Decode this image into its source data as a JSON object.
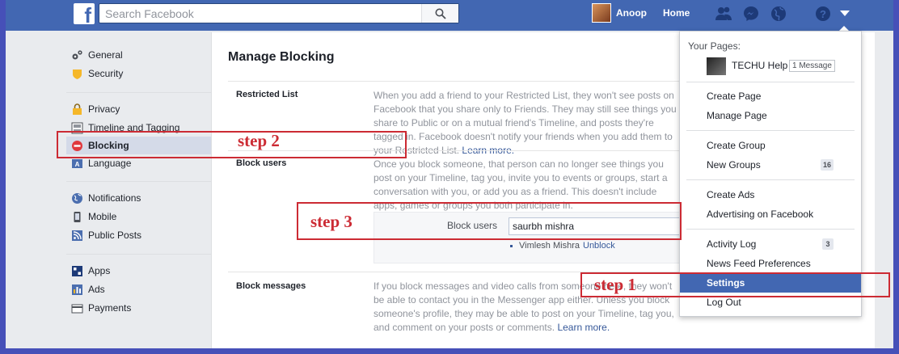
{
  "topbar": {
    "search_placeholder": "Search Facebook",
    "user_name": "Anoop",
    "home_label": "Home",
    "logo": "f"
  },
  "leftnav": {
    "groups": [
      [
        {
          "label": "General",
          "icon": "gear-icon"
        },
        {
          "label": "Security",
          "icon": "shield-icon"
        }
      ],
      [
        {
          "label": "Privacy",
          "icon": "lock-icon"
        },
        {
          "label": "Timeline and Tagging",
          "icon": "timeline-icon"
        },
        {
          "label": "Blocking",
          "icon": "block-icon",
          "active": true
        },
        {
          "label": "Language",
          "icon": "language-icon"
        }
      ],
      [
        {
          "label": "Notifications",
          "icon": "globe-icon"
        },
        {
          "label": "Mobile",
          "icon": "mobile-icon"
        },
        {
          "label": "Public Posts",
          "icon": "rss-icon"
        }
      ],
      [
        {
          "label": "Apps",
          "icon": "apps-icon"
        },
        {
          "label": "Ads",
          "icon": "ads-icon"
        },
        {
          "label": "Payments",
          "icon": "card-icon"
        }
      ]
    ]
  },
  "main": {
    "title": "Manage Blocking",
    "restricted": {
      "label": "Restricted List",
      "text": "When you add a friend to your Restricted List, they won't see posts on Facebook that you share only to Friends. They may still see things you share to Public or on a mutual friend's Timeline, and posts they're tagged in. Facebook doesn't notify your friends when you add them to your Restricted List.",
      "link": "Learn more."
    },
    "block_users": {
      "label": "Block users",
      "text": "Once you block someone, that person can no longer see things you post on your Timeline, tag you, invite you to events or groups, start a conversation with you, or add you as a friend. This doesn't include apps, games or groups you both participate in.",
      "field_label": "Block users",
      "field_value": "saurbh mishra",
      "blocked_name": "Vimlesh Mishra",
      "unblock_label": "Unblock"
    },
    "block_messages": {
      "label": "Block messages",
      "text": "If you block messages and video calls from someone here, they won't be able to contact you in the Messenger app either. Unless you block someone's profile, they may be able to post on your Timeline, tag you, and comment on your posts or comments.",
      "link": "Learn more."
    }
  },
  "dropdown": {
    "your_pages_label": "Your Pages:",
    "page_name": "TECHU Help",
    "page_badge": "1 Message",
    "items": [
      {
        "label": "Create Page"
      },
      {
        "label": "Manage Page"
      },
      {
        "label": "Create Group"
      },
      {
        "label": "New Groups",
        "count": "16"
      },
      {
        "label": "Create Ads"
      },
      {
        "label": "Advertising on Facebook"
      },
      {
        "label": "Activity Log",
        "count": "3"
      },
      {
        "label": "News Feed Preferences"
      },
      {
        "label": "Settings",
        "selected": true
      },
      {
        "label": "Log Out"
      }
    ]
  },
  "annotations": {
    "step1": "step 1",
    "step2": "step 2",
    "step3": "step 3",
    "color": "#cc2b34"
  },
  "colors": {
    "brand": "#4267b2",
    "link": "#365899",
    "frame_border": "#4650b8"
  }
}
